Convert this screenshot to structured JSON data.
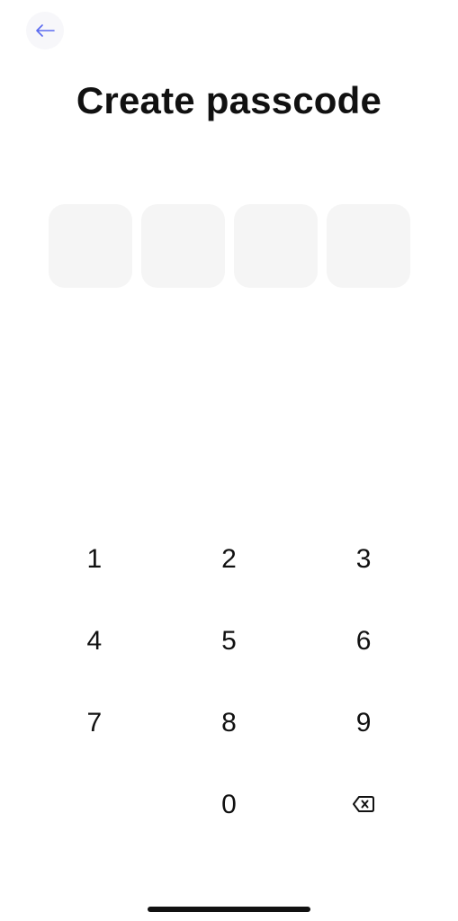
{
  "header": {
    "back_icon": "arrow-left-icon",
    "title": "Create passcode"
  },
  "passcode": {
    "length": 4,
    "entered": 0
  },
  "keypad": {
    "keys": [
      "1",
      "2",
      "3",
      "4",
      "5",
      "6",
      "7",
      "8",
      "9",
      "",
      "0"
    ],
    "delete_icon": "backspace-icon"
  },
  "colors": {
    "accent": "#5b6bf0",
    "text": "#111111",
    "box_fill": "#f5f5f5",
    "back_button_bg": "#f7f7fa"
  }
}
